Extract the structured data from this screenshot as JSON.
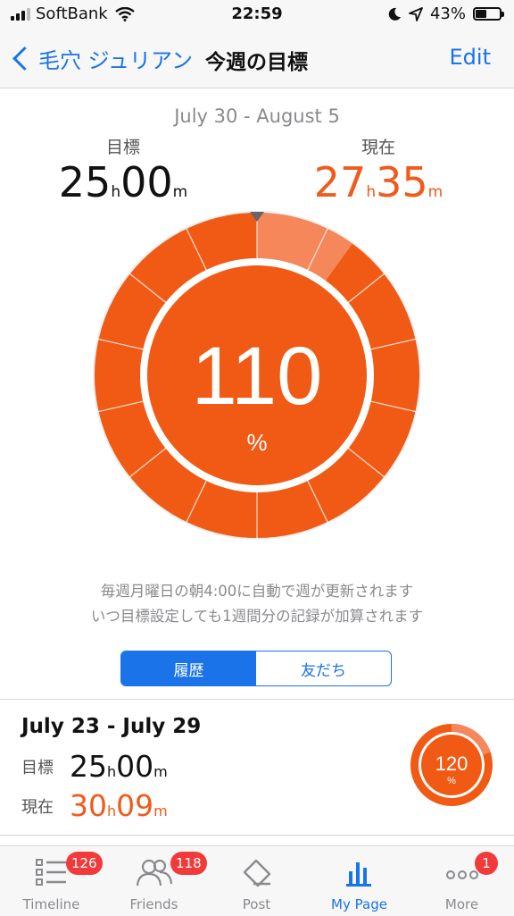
{
  "status_bar": {
    "carrier": "SoftBank",
    "time": "22:59",
    "battery": "43%",
    "battery_level": 0.43
  },
  "nav": {
    "back_label": "毛穴 ジュリアン",
    "title": "今週の目標",
    "edit_label": "Edit"
  },
  "week": {
    "range": "July 30 - August 5",
    "goal_label": "目標",
    "goal_h": "25",
    "goal_m": "00",
    "current_label": "現在",
    "current_h": "27",
    "current_m": "35",
    "percent": "110",
    "percent_sign": "%",
    "unit_h": "h",
    "unit_m": "m",
    "progress": 1.1
  },
  "notice": {
    "line1": "毎週月曜日の朝4:00に自動で週が更新されます",
    "line2": "いつ目標設定しても1週間分の記録が加算されます"
  },
  "segmented": {
    "history": "履歴",
    "friends": "友だち"
  },
  "history": [
    {
      "range": "July 23 - July 29",
      "goal_label": "目標",
      "goal_h": "25",
      "goal_m": "00",
      "current_label": "現在",
      "current_h": "30",
      "current_m": "09",
      "percent": "120",
      "percent_sign": "%",
      "progress": 1.2
    }
  ],
  "tabs": [
    {
      "label": "Timeline",
      "icon": "list-icon",
      "badge": "126"
    },
    {
      "label": "Friends",
      "icon": "friends-icon",
      "badge": "118"
    },
    {
      "label": "Post",
      "icon": "tag-icon",
      "badge": ""
    },
    {
      "label": "My Page",
      "icon": "bar-chart-icon",
      "badge": "",
      "active": true
    },
    {
      "label": "More",
      "icon": "more-dots-icon",
      "badge": "1"
    }
  ],
  "colors": {
    "accent": "#1a73e8",
    "ring_orange": "#f05a14",
    "ring_light": "#f5875a",
    "badge_red": "#f23a3a"
  }
}
